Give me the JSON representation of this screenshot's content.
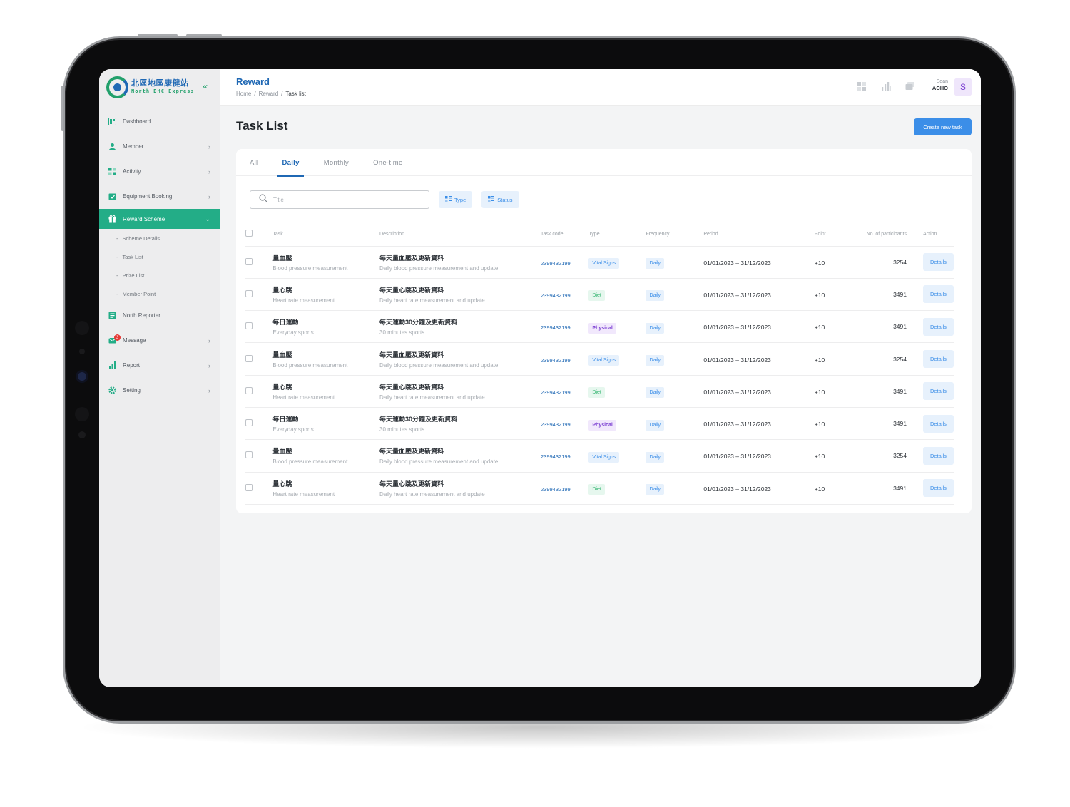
{
  "colors": {
    "brand_green": "#23ad87",
    "brand_blue": "#1f68b4",
    "accent_blue": "#3b8ee8",
    "tag_purple": "#7b3fd2",
    "tag_green": "#2fb36d"
  },
  "brand": {
    "zh": "北區地區康健站",
    "en": "North DHC Express",
    "collapse_icon": "double-chevron-left-icon"
  },
  "sidebar": {
    "items": [
      {
        "label": "Dashboard",
        "icon": "dashboard-icon"
      },
      {
        "label": "Member",
        "icon": "member-icon"
      },
      {
        "label": "Activity",
        "icon": "activity-icon"
      },
      {
        "label": "Equipment Booking",
        "icon": "calendar-check-icon"
      },
      {
        "label": "Reward Scheme",
        "icon": "gift-icon"
      },
      {
        "label": "North Reporter",
        "icon": "newspaper-icon"
      },
      {
        "label": "Message",
        "icon": "mail-icon",
        "badge": "3"
      },
      {
        "label": "Report",
        "icon": "bar-chart-icon"
      },
      {
        "label": "Setting",
        "icon": "gear-icon"
      }
    ],
    "sub_items": [
      {
        "label": "Scheme Details"
      },
      {
        "label": "Task List"
      },
      {
        "label": "Prize List"
      },
      {
        "label": "Member Point"
      }
    ]
  },
  "header": {
    "title": "Reward",
    "breadcrumb": [
      "Home",
      "Reward",
      "Task list"
    ],
    "user_first": "Sean",
    "user_org": "ACHO",
    "avatar_initial": "S"
  },
  "main": {
    "title": "Task List",
    "create_label": "Create new task",
    "tabs": [
      "All",
      "Daily",
      "Monthly",
      "One-time"
    ],
    "active_tab": "Daily",
    "search_placeholder": "Title",
    "filter_type": "Type",
    "filter_status": "Status"
  },
  "table": {
    "columns": [
      "Task",
      "Description",
      "Task code",
      "Type",
      "Frequency",
      "Period",
      "Point",
      "No. of participants",
      "Action"
    ],
    "rows": [
      {
        "task_zh": "量血壓",
        "task_en": "Blood pressure measurement",
        "desc_zh": "每天量血壓及更新資料",
        "desc_en": "Daily blood pressure measurement and update",
        "code": "2399432199",
        "type": "Vital Signs",
        "type_color": "blue",
        "freq": "Daily",
        "period": "01/01/2023 – 31/12/2023",
        "point": "+10",
        "participants": "3254",
        "action": "Details"
      },
      {
        "task_zh": "量心跳",
        "task_en": "Heart rate measurement",
        "desc_zh": "每天量心跳及更新資料",
        "desc_en": "Daily heart rate measurement and update",
        "code": "2399432199",
        "type": "Diet",
        "type_color": "green",
        "freq": "Daily",
        "period": "01/01/2023 – 31/12/2023",
        "point": "+10",
        "participants": "3491",
        "action": "Details"
      },
      {
        "task_zh": "每日運動",
        "task_en": "Everyday sports",
        "desc_zh": "每天運動30分鐘及更新資料",
        "desc_en": "30 minutes sports",
        "code": "2399432199",
        "type": "Physical",
        "type_color": "purple",
        "freq": "Daily",
        "period": "01/01/2023 – 31/12/2023",
        "point": "+10",
        "participants": "3491",
        "action": "Details"
      },
      {
        "task_zh": "量血壓",
        "task_en": "Blood pressure measurement",
        "desc_zh": "每天量血壓及更新資料",
        "desc_en": "Daily blood pressure measurement and update",
        "code": "2399432199",
        "type": "Vital Signs",
        "type_color": "blue",
        "freq": "Daily",
        "period": "01/01/2023 – 31/12/2023",
        "point": "+10",
        "participants": "3254",
        "action": "Details"
      },
      {
        "task_zh": "量心跳",
        "task_en": "Heart rate measurement",
        "desc_zh": "每天量心跳及更新資料",
        "desc_en": "Daily heart rate measurement and update",
        "code": "2399432199",
        "type": "Diet",
        "type_color": "green",
        "freq": "Daily",
        "period": "01/01/2023 – 31/12/2023",
        "point": "+10",
        "participants": "3491",
        "action": "Details"
      },
      {
        "task_zh": "每日運動",
        "task_en": "Everyday sports",
        "desc_zh": "每天運動30分鐘及更新資料",
        "desc_en": "30 minutes sports",
        "code": "2399432199",
        "type": "Physical",
        "type_color": "purple",
        "freq": "Daily",
        "period": "01/01/2023 – 31/12/2023",
        "point": "+10",
        "participants": "3491",
        "action": "Details"
      },
      {
        "task_zh": "量血壓",
        "task_en": "Blood pressure measurement",
        "desc_zh": "每天量血壓及更新資料",
        "desc_en": "Daily blood pressure measurement and update",
        "code": "2399432199",
        "type": "Vital Signs",
        "type_color": "blue",
        "freq": "Daily",
        "period": "01/01/2023 – 31/12/2023",
        "point": "+10",
        "participants": "3254",
        "action": "Details"
      },
      {
        "task_zh": "量心跳",
        "task_en": "Heart rate measurement",
        "desc_zh": "每天量心跳及更新資料",
        "desc_en": "Daily heart rate measurement and update",
        "code": "2399432199",
        "type": "Diet",
        "type_color": "green",
        "freq": "Daily",
        "period": "01/01/2023 – 31/12/2023",
        "point": "+10",
        "participants": "3491",
        "action": "Details"
      }
    ]
  }
}
